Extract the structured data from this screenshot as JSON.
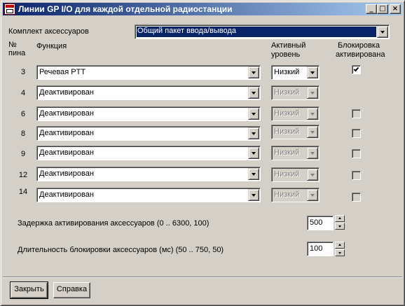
{
  "window": {
    "title": "Линии GP I/O для каждой отдельной радиостанции",
    "minimize": "_",
    "maximize": "□",
    "close": "×"
  },
  "kit": {
    "label": "Комплект аксессуаров",
    "value": "Общий пакет ввода/вывода"
  },
  "headers": {
    "pin_line1": "№",
    "pin_line2": "пина",
    "function": "Функция",
    "active_line1": "Активный",
    "active_line2": "уровень",
    "lock_line1": "Блокировка",
    "lock_line2": "активирована"
  },
  "rows": [
    {
      "pin": "3",
      "function": "Речевая PTT",
      "level": "Низкий",
      "level_enabled": true,
      "lock_checked": true,
      "lock_visible": true
    },
    {
      "pin": "4",
      "function": "Деактивирован",
      "level": "Низкий",
      "level_enabled": false,
      "lock_checked": false,
      "lock_visible": false
    },
    {
      "pin": "6",
      "function": "Деактивирован",
      "level": "Низкий",
      "level_enabled": false,
      "lock_checked": false,
      "lock_visible": true
    },
    {
      "pin": "8",
      "function": "Деактивирован",
      "level": "Низкий",
      "level_enabled": false,
      "lock_checked": false,
      "lock_visible": true
    },
    {
      "pin": "9",
      "function": "Деактивирован",
      "level": "Низкий",
      "level_enabled": false,
      "lock_checked": false,
      "lock_visible": true
    },
    {
      "pin": "12",
      "function": "Деактивирован",
      "level": "Низкий",
      "level_enabled": false,
      "lock_checked": false,
      "lock_visible": true
    },
    {
      "pin": "14",
      "function": "Деактивирован",
      "level": "Низкий",
      "level_enabled": false,
      "lock_checked": false,
      "lock_visible": true
    }
  ],
  "delay": {
    "label": "Задержка активирования аксессуаров (0 .. 6300, 100)",
    "value": "500"
  },
  "lock_duration": {
    "label": "Длительность блокировки аксессуаров (мс) (50 .. 750, 50)",
    "value": "100"
  },
  "buttons": {
    "close": "Закрыть",
    "help": "Справка"
  },
  "colors": {
    "face": "#d4d0c8",
    "title_start": "#0a246a",
    "title_end": "#a6caf0",
    "selection": "#0a246a"
  }
}
